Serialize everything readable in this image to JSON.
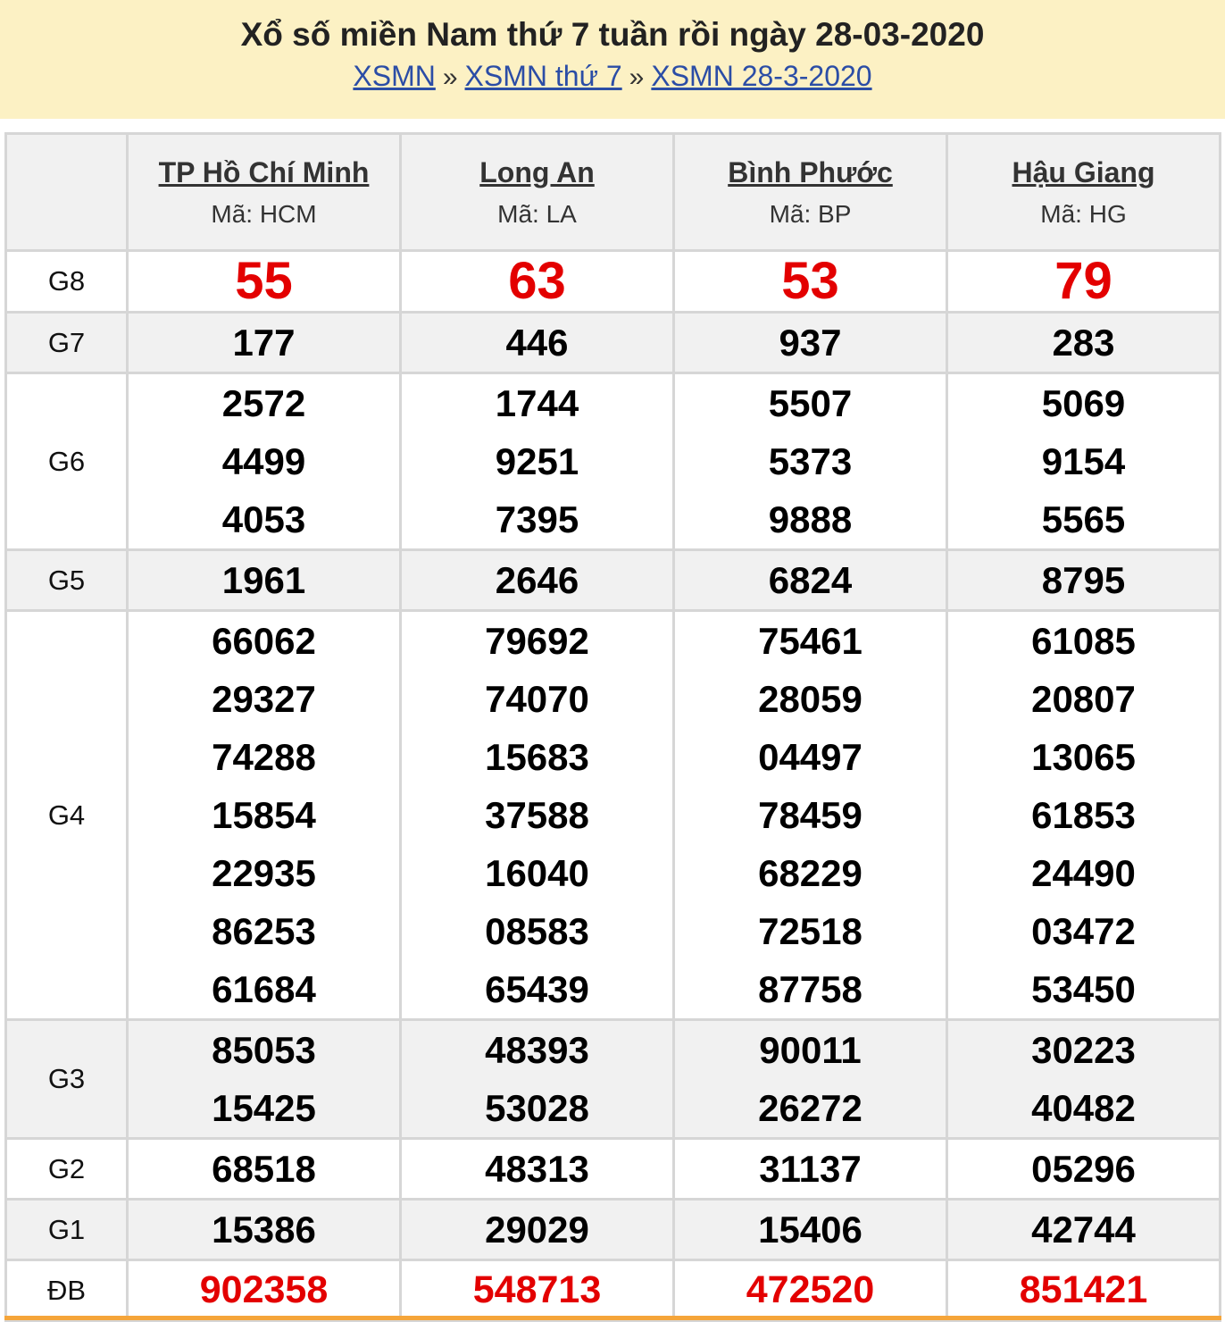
{
  "header": {
    "title": "Xổ số miền Nam thứ 7 tuần rồi ngày 28-03-2020",
    "breadcrumb": [
      {
        "label": "XSMN"
      },
      {
        "label": "XSMN thứ 7"
      },
      {
        "label": "XSMN 28-3-2020"
      }
    ],
    "separator": "»"
  },
  "provinces": [
    {
      "name": "TP Hồ Chí Minh",
      "code": "Mã: HCM"
    },
    {
      "name": "Long An",
      "code": "Mã: LA"
    },
    {
      "name": "Bình Phước",
      "code": "Mã: BP"
    },
    {
      "name": "Hậu Giang",
      "code": "Mã: HG"
    }
  ],
  "prizes": [
    {
      "label": "G8",
      "values": [
        [
          "55"
        ],
        [
          "63"
        ],
        [
          "53"
        ],
        [
          "79"
        ]
      ]
    },
    {
      "label": "G7",
      "values": [
        [
          "177"
        ],
        [
          "446"
        ],
        [
          "937"
        ],
        [
          "283"
        ]
      ]
    },
    {
      "label": "G6",
      "values": [
        [
          "2572",
          "4499",
          "4053"
        ],
        [
          "1744",
          "9251",
          "7395"
        ],
        [
          "5507",
          "5373",
          "9888"
        ],
        [
          "5069",
          "9154",
          "5565"
        ]
      ]
    },
    {
      "label": "G5",
      "values": [
        [
          "1961"
        ],
        [
          "2646"
        ],
        [
          "6824"
        ],
        [
          "8795"
        ]
      ]
    },
    {
      "label": "G4",
      "values": [
        [
          "66062",
          "29327",
          "74288",
          "15854",
          "22935",
          "86253",
          "61684"
        ],
        [
          "79692",
          "74070",
          "15683",
          "37588",
          "16040",
          "08583",
          "65439"
        ],
        [
          "75461",
          "28059",
          "04497",
          "78459",
          "68229",
          "72518",
          "87758"
        ],
        [
          "61085",
          "20807",
          "13065",
          "61853",
          "24490",
          "03472",
          "53450"
        ]
      ]
    },
    {
      "label": "G3",
      "values": [
        [
          "85053",
          "15425"
        ],
        [
          "48393",
          "53028"
        ],
        [
          "90011",
          "26272"
        ],
        [
          "30223",
          "40482"
        ]
      ]
    },
    {
      "label": "G2",
      "values": [
        [
          "68518"
        ],
        [
          "48313"
        ],
        [
          "31137"
        ],
        [
          "05296"
        ]
      ]
    },
    {
      "label": "G1",
      "values": [
        [
          "15386"
        ],
        [
          "29029"
        ],
        [
          "15406"
        ],
        [
          "42744"
        ]
      ]
    },
    {
      "label": "ĐB",
      "values": [
        [
          "902358"
        ],
        [
          "548713"
        ],
        [
          "472520"
        ],
        [
          "851421"
        ]
      ]
    }
  ],
  "colors": {
    "header_bg": "#fcf1c4",
    "link": "#2b4da6",
    "highlight_red": "#e30000",
    "row_gray": "#f1f1f1",
    "border": "#d6d6d6",
    "bottom_accent": "#f5a53a"
  }
}
